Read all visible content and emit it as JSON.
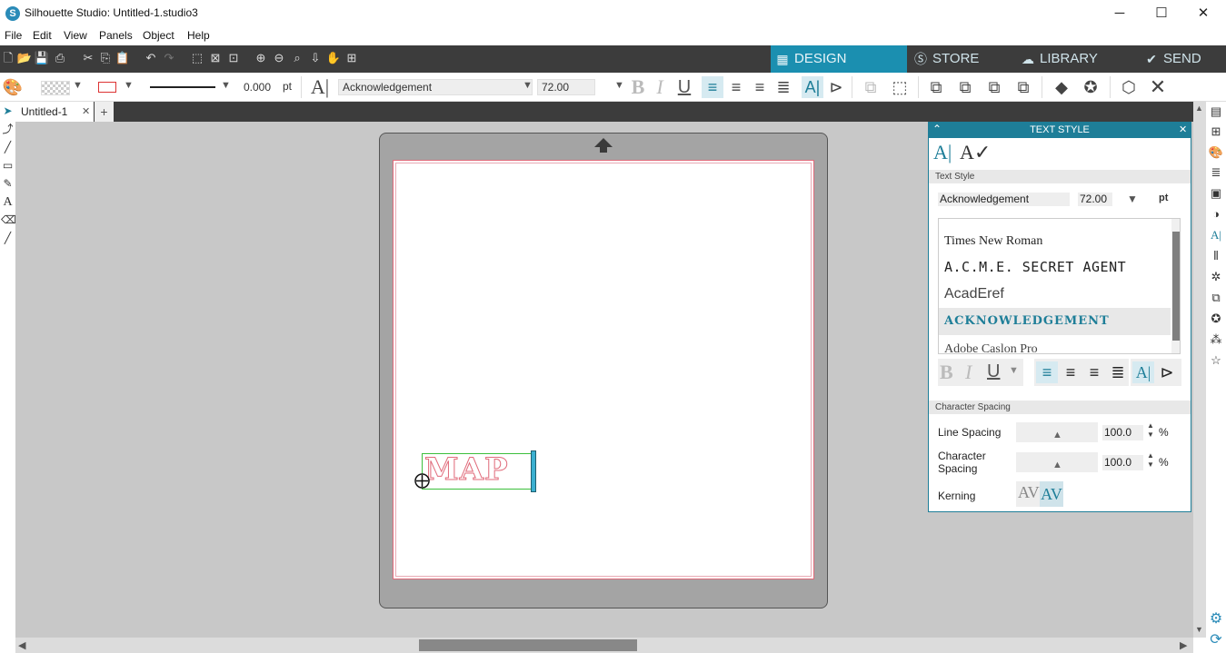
{
  "window": {
    "title": "Silhouette Studio: Untitled-1.studio3",
    "minimize_glyph": "─",
    "maximize_glyph": "☐",
    "close_glyph": "✕"
  },
  "menu": [
    "File",
    "Edit",
    "View",
    "Panels",
    "Object",
    "Help"
  ],
  "nav_tabs": [
    {
      "label": "DESIGN",
      "icon": "grid-icon",
      "active": true
    },
    {
      "label": "STORE",
      "icon": "silhouette-s-icon",
      "active": false
    },
    {
      "label": "LIBRARY",
      "icon": "cloud-icon",
      "active": false
    },
    {
      "label": "SEND",
      "icon": "check-circle-icon",
      "active": false
    }
  ],
  "toolbar2": {
    "line_width": "0.000",
    "line_width_unit": "pt",
    "font_name": "Acknowledgement",
    "font_size": "72.00"
  },
  "doc_tabs": {
    "current": "Untitled-1",
    "add_glyph": "+",
    "close_glyph": "✕"
  },
  "canvas": {
    "text_object": "MAP"
  },
  "text_style_panel": {
    "title": "TEXT STYLE",
    "section_label": "Text Style",
    "font_field": "Acknowledgement",
    "size_field": "72.00",
    "size_unit": "pt",
    "font_list": [
      {
        "name": "Times New Roman",
        "preview": "Times New Roman",
        "selected": false
      },
      {
        "name": "A.C.M.E. Secret Agent",
        "preview": "A.C.M.E. SECRET AGENT",
        "selected": false
      },
      {
        "name": "AcadEref",
        "preview": "AcadEref",
        "selected": false
      },
      {
        "name": "Acknowledgement",
        "preview": "ACKNOWLEDGEMENT",
        "selected": true
      },
      {
        "name": "Adobe Caslon Pro",
        "preview": "Adobe Caslon Pro",
        "selected": false
      }
    ],
    "spacing_section": "Character Spacing",
    "line_spacing_label": "Line Spacing",
    "line_spacing_value": "100.0",
    "char_spacing_label": "Character Spacing",
    "char_spacing_value": "100.0",
    "percent": "%",
    "kerning_label": "Kerning",
    "kerning_glyph": "AV"
  },
  "colors": {
    "accent": "#1e7e98",
    "active_tab": "#1b8fb0",
    "dark_bar": "#3c3c3c",
    "workspace": "#c8c8c8",
    "mat": "#a4a4a4",
    "cut_line": "#e06a7a"
  }
}
